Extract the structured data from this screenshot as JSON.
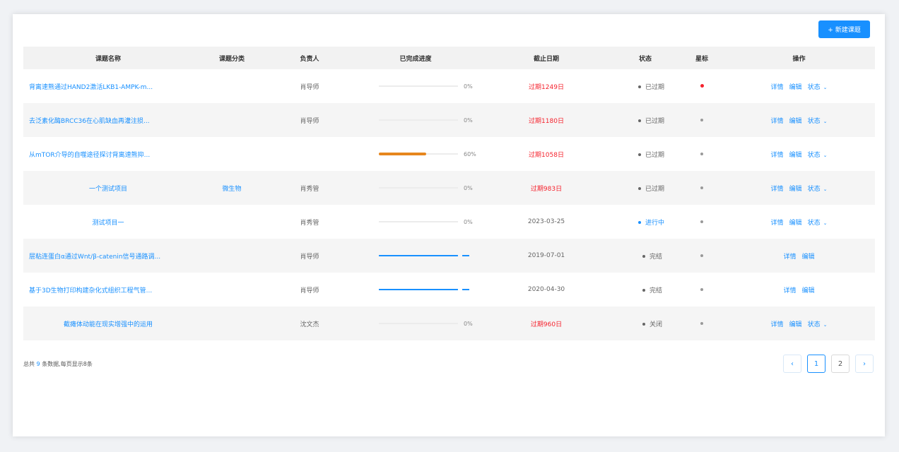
{
  "toolbar": {
    "new_label": "+ 新建课题"
  },
  "columns": [
    "课题名称",
    "课题分类",
    "负责人",
    "已完成进度",
    "截止日期",
    "状态",
    "星标",
    "操作"
  ],
  "rows": [
    {
      "name": "背离速熊通过HAND2激活LKB1-AMPK-m...",
      "category": "",
      "owner": "肖导师",
      "progress": 0,
      "progress_label": "0%",
      "date": "过期1249日",
      "overdue": true,
      "status": "已过期",
      "starred": true,
      "ops": [
        "详情",
        "编辑",
        "状态"
      ]
    },
    {
      "name": "去泛素化酶BRCC36在心肌缺血再灌注损...",
      "category": "",
      "owner": "肖导师",
      "progress": 0,
      "progress_label": "0%",
      "date": "过期1180日",
      "overdue": true,
      "status": "已过期",
      "starred": false,
      "ops": [
        "详情",
        "编辑",
        "状态"
      ]
    },
    {
      "name": "从mTOR介导的自噬途径探讨背离速熊抑...",
      "category": "",
      "owner": "",
      "progress": 60,
      "progress_label": "60%",
      "date": "过期1058日",
      "overdue": true,
      "status": "已过期",
      "starred": false,
      "ops": [
        "详情",
        "编辑",
        "状态"
      ]
    },
    {
      "name": "一个测试项目",
      "category": "微生物",
      "owner": "肖秀管",
      "progress": 0,
      "progress_label": "0%",
      "date": "过期983日",
      "overdue": true,
      "status": "已过期",
      "starred": false,
      "ops": [
        "详情",
        "编辑",
        "状态"
      ]
    },
    {
      "name": "测试项目一",
      "category": "",
      "owner": "肖秀管",
      "progress": 0,
      "progress_label": "0%",
      "date": "2023-03-25",
      "overdue": false,
      "status": "进行中",
      "starred": false,
      "ops": [
        "详情",
        "编辑",
        "状态"
      ]
    },
    {
      "name": "层粘连蛋白α通过Wnt/β-catenin信号通路调...",
      "category": "",
      "owner": "肖导师",
      "progress": 100,
      "progress_label": "",
      "date": "2019-07-01",
      "overdue": false,
      "status": "完结",
      "starred": false,
      "ops": [
        "详情",
        "编辑"
      ]
    },
    {
      "name": "基于3D生物打印构建杂化式组织工程气管...",
      "category": "",
      "owner": "肖导师",
      "progress": 100,
      "progress_label": "",
      "date": "2020-04-30",
      "overdue": false,
      "status": "完结",
      "starred": false,
      "ops": [
        "详情",
        "编辑"
      ]
    },
    {
      "name": "截瘫体动能在现实增强中的运用",
      "category": "",
      "owner": "沈文杰",
      "progress": 0,
      "progress_label": "0%",
      "date": "过期960日",
      "overdue": true,
      "status": "关闭",
      "starred": false,
      "ops": [
        "详情",
        "编辑",
        "状态"
      ]
    }
  ],
  "footer": {
    "prefix": "总共",
    "count": "9",
    "suffix": "条数据,每页显示8条"
  },
  "pagination": {
    "prev": "‹",
    "pages": [
      "1",
      "2"
    ],
    "current": "1",
    "next": "›"
  },
  "colors": {
    "accent": "#1890ff",
    "danger": "#f5222d",
    "warn_progress": "#e6861d"
  }
}
